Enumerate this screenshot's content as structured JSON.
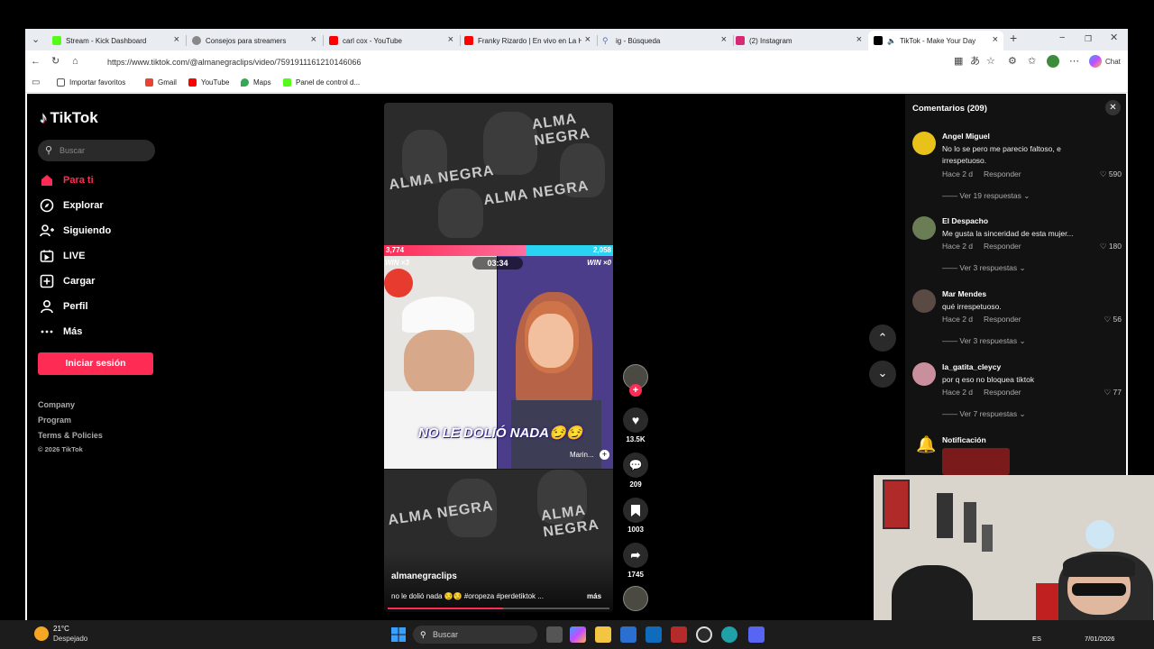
{
  "browser": {
    "tabs": [
      {
        "title": "Stream - Kick Dashboard",
        "color": "#53fc18"
      },
      {
        "title": "Consejos para streamers",
        "color": "#888888"
      },
      {
        "title": "carl cox - YouTube",
        "color": "#ff0000"
      },
      {
        "title": "Franky Rizardo | En vivo en La Hua",
        "color": "#ff0000"
      },
      {
        "title": "ig - Búsqueda",
        "color": "#4a7bd6"
      },
      {
        "title": "(2) Instagram",
        "color": "#d62976"
      },
      {
        "title": "TikTok - Make Your Day",
        "color": "#000000"
      }
    ],
    "url": "https://www.tiktok.com/@almanegraclips/video/7591911161210146066",
    "chat_label": "Chat",
    "bookmarks": [
      "Importar favoritos",
      "Gmail",
      "YouTube",
      "Maps",
      "Panel de control d..."
    ]
  },
  "tiktok": {
    "logo": "TikTok",
    "search_placeholder": "Buscar",
    "nav": [
      {
        "label": "Para ti",
        "icon": "home-icon",
        "active": true
      },
      {
        "label": "Explorar",
        "icon": "compass-icon"
      },
      {
        "label": "Siguiendo",
        "icon": "following-icon"
      },
      {
        "label": "LIVE",
        "icon": "live-icon"
      },
      {
        "label": "Cargar",
        "icon": "upload-icon"
      },
      {
        "label": "Perfil",
        "icon": "profile-icon"
      },
      {
        "label": "Más",
        "icon": "more-icon"
      }
    ],
    "login_button": "Iniciar sesión",
    "footer": [
      "Company",
      "Program",
      "Terms & Policies",
      "© 2026 TikTok"
    ],
    "video": {
      "score_left": "3,774",
      "score_right": "2,058",
      "timer": "03:34",
      "win_left": "WIN ×3",
      "win_right": "WIN ×0",
      "overlay_text": "NO LE DOLIÓ NADA😏😏",
      "streamer_name": "Marin...",
      "banner_text": "ALMA NEGRA",
      "author": "almanegraclips",
      "caption": "no le dolió nada 😏😏 #oropeza #perdetiktok ...",
      "more": "más"
    },
    "actions": {
      "likes": "13.5K",
      "comments": "209",
      "saves": "1003",
      "shares": "1745"
    },
    "comments_panel": {
      "title": "Comentarios (209)",
      "items": [
        {
          "user": "Angel Miguel",
          "text": "No lo se pero me parecio faltoso, e irrespetuoso.",
          "time": "Hace 2 d",
          "reply": "Responder",
          "likes": "590",
          "replies": "Ver 19 respuestas",
          "avatar_color": "#e8c21a"
        },
        {
          "user": "El Despacho",
          "text": "Me gusta la sinceridad de esta mujer...",
          "time": "Hace 2 d",
          "reply": "Responder",
          "likes": "180",
          "replies": "Ver 3 respuestas",
          "avatar_color": "#6b7d54"
        },
        {
          "user": "Mar Mendes",
          "text": "qué irrespetuoso.",
          "time": "Hace 2 d",
          "reply": "Responder",
          "likes": "56",
          "replies": "Ver 3 respuestas",
          "avatar_color": "#5a4a44"
        },
        {
          "user": "la_gatita_cleycy",
          "text": "por q eso no bloquea tiktok",
          "time": "Hace 2 d",
          "reply": "Responder",
          "likes": "77",
          "replies": "Ver 7 respuestas",
          "avatar_color": "#c98f9c"
        }
      ],
      "notification": "Notificación"
    }
  },
  "taskbar": {
    "weather_temp": "21°C",
    "weather_desc": "Despejado",
    "search_placeholder": "Buscar",
    "lang": "ES",
    "date": "7/01/2026"
  }
}
